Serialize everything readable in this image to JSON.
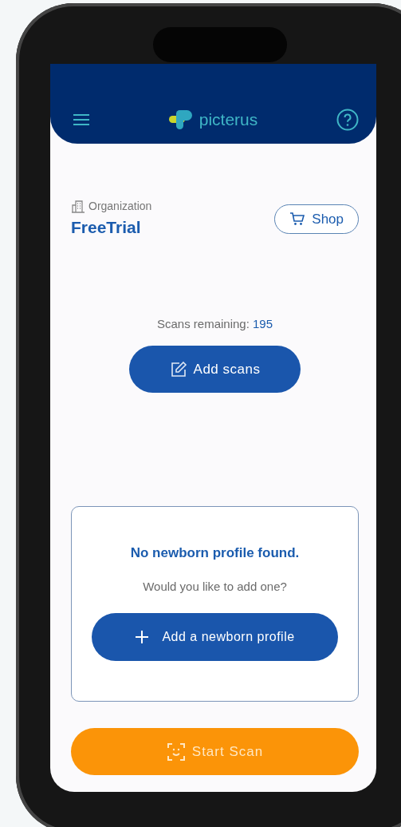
{
  "header": {
    "brand": "picterus"
  },
  "organization": {
    "label": "Organization",
    "name": "FreeTrial"
  },
  "shop_button": {
    "label": "Shop"
  },
  "scans": {
    "label": "Scans remaining:",
    "count": "195"
  },
  "add_scans_button": {
    "label": "Add scans"
  },
  "newborn_card": {
    "title": "No newborn profile found.",
    "prompt": "Would you like to add one?",
    "button": "Add a newborn profile"
  },
  "start_scan_button": {
    "label": "Start Scan"
  }
}
